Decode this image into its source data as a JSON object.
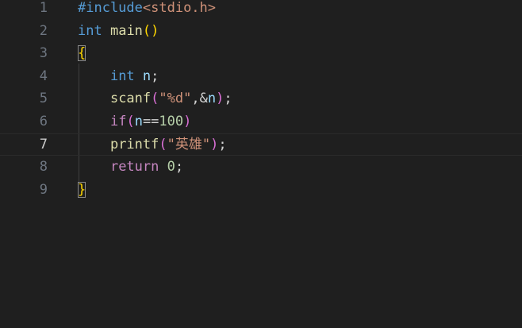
{
  "editor": {
    "current_line": 7,
    "lines": [
      {
        "number": "1",
        "tokens": [
          {
            "text": "#include",
            "kind": "directive"
          },
          {
            "text": "<stdio.h>",
            "kind": "include"
          }
        ]
      },
      {
        "number": "2",
        "tokens": [
          {
            "text": "int",
            "kind": "keyword"
          },
          {
            "text": " ",
            "kind": "plain"
          },
          {
            "text": "main",
            "kind": "func"
          },
          {
            "text": "()",
            "kind": "paren1"
          }
        ]
      },
      {
        "number": "3",
        "tokens": [
          {
            "text": "{",
            "kind": "paren1",
            "boxed": true
          }
        ]
      },
      {
        "number": "4",
        "tokens": [
          {
            "text": "    ",
            "kind": "plain"
          },
          {
            "text": "int",
            "kind": "keyword"
          },
          {
            "text": " ",
            "kind": "plain"
          },
          {
            "text": "n",
            "kind": "ident"
          },
          {
            "text": ";",
            "kind": "plain"
          }
        ]
      },
      {
        "number": "5",
        "tokens": [
          {
            "text": "    ",
            "kind": "plain"
          },
          {
            "text": "scanf",
            "kind": "func"
          },
          {
            "text": "(",
            "kind": "paren2"
          },
          {
            "text": "\"%d\"",
            "kind": "string"
          },
          {
            "text": ",&",
            "kind": "plain"
          },
          {
            "text": "n",
            "kind": "ident"
          },
          {
            "text": ")",
            "kind": "paren2"
          },
          {
            "text": ";",
            "kind": "plain"
          }
        ]
      },
      {
        "number": "6",
        "tokens": [
          {
            "text": "    ",
            "kind": "plain"
          },
          {
            "text": "if",
            "kind": "control"
          },
          {
            "text": "(",
            "kind": "paren2"
          },
          {
            "text": "n",
            "kind": "ident"
          },
          {
            "text": "==",
            "kind": "plain"
          },
          {
            "text": "100",
            "kind": "number"
          },
          {
            "text": ")",
            "kind": "paren2"
          }
        ]
      },
      {
        "number": "7",
        "tokens": [
          {
            "text": "    ",
            "kind": "plain"
          },
          {
            "text": "printf",
            "kind": "func"
          },
          {
            "text": "(",
            "kind": "paren2"
          },
          {
            "text": "\"英雄\"",
            "kind": "string"
          },
          {
            "text": ")",
            "kind": "paren2"
          },
          {
            "text": ";",
            "kind": "plain"
          }
        ]
      },
      {
        "number": "8",
        "tokens": [
          {
            "text": "    ",
            "kind": "plain"
          },
          {
            "text": "return",
            "kind": "control"
          },
          {
            "text": " ",
            "kind": "plain"
          },
          {
            "text": "0",
            "kind": "number"
          },
          {
            "text": ";",
            "kind": "plain"
          }
        ]
      },
      {
        "number": "9",
        "tokens": [
          {
            "text": "}",
            "kind": "paren1",
            "boxed": true
          }
        ]
      }
    ]
  }
}
